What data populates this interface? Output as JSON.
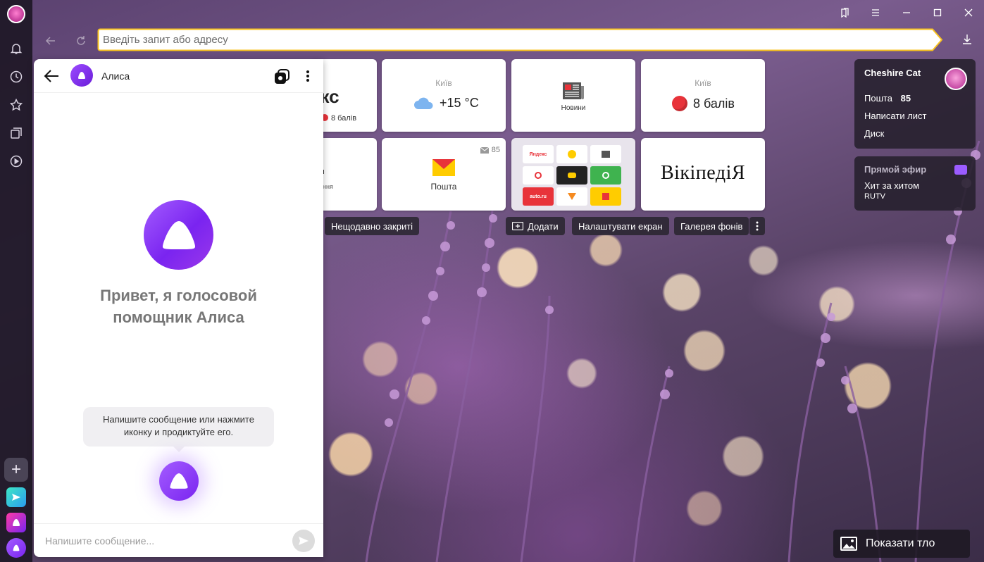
{
  "browser": {
    "address_placeholder": "Введіть запит або адресу"
  },
  "tiles": {
    "yandex_partial": {
      "text": "екс",
      "score": "8 балів"
    },
    "weather": {
      "city": "Київ",
      "temp": "+15 °C"
    },
    "news": {
      "label": "Новини"
    },
    "traffic": {
      "city": "Київ",
      "score": "8 балів"
    },
    "partial_left": {
      "text": "ння"
    },
    "mail": {
      "label": "Пошта",
      "count": "85"
    },
    "wiki": {
      "text": "ВікіпедіЯ"
    },
    "mini_apps": [
      "Яндекс",
      "",
      "",
      "",
      "",
      "",
      "auto.ru",
      "",
      ""
    ]
  },
  "actions": {
    "recently_closed": "Нещодавно закриті",
    "add": "Додати",
    "customize": "Налаштувати екран",
    "gallery": "Галерея фонів"
  },
  "user_card": {
    "name": "Cheshire Cat",
    "mail_label": "Пошта",
    "mail_count": "85",
    "write": "Написати лист",
    "disk": "Диск"
  },
  "live": {
    "title": "Прямой эфир",
    "show": "Хит за хитом",
    "channel": "RUTV"
  },
  "show_background": "Показати тло",
  "alice": {
    "name": "Алиса",
    "greeting_line1": "Привет, я голосовой",
    "greeting_line2": "помощник Алиса",
    "hint_line1": "Напишите сообщение или нажмите",
    "hint_line2": "иконку и продиктуйте его.",
    "input_placeholder": "Напишите сообщение..."
  }
}
